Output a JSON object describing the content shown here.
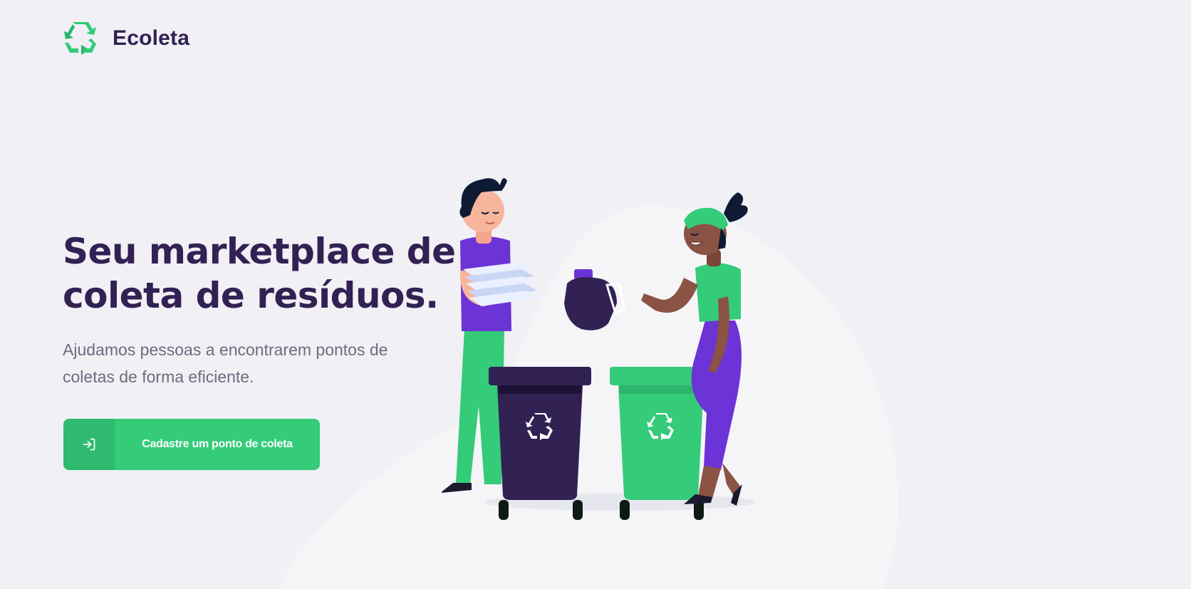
{
  "app": {
    "name": "Ecoleta"
  },
  "hero": {
    "title_line1": "Seu marketplace de",
    "title_line2": "coleta de resíduos.",
    "description": "Ajudamos pessoas a encontrarem pontos de coletas de forma eficiente."
  },
  "cta": {
    "label": "Cadastre um ponto de coleta",
    "icon": "log-in-icon"
  },
  "colors": {
    "background": "#F0F0F5",
    "primary_green": "#34CB79",
    "title_purple": "#322153",
    "text_gray": "#6C6C80",
    "accent_purple": "#6C33D6"
  }
}
